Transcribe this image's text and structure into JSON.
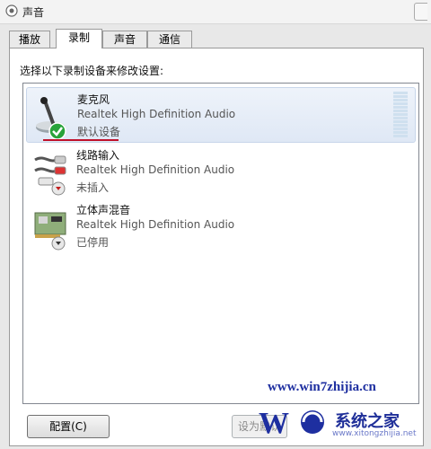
{
  "window": {
    "title": "声音"
  },
  "tabs": [
    {
      "label": "播放"
    },
    {
      "label": "录制"
    },
    {
      "label": "声音"
    },
    {
      "label": "通信"
    }
  ],
  "active_tab_index": 1,
  "prompt": "选择以下录制设备来修改设置:",
  "devices": [
    {
      "name": "麦克风",
      "driver": "Realtek High Definition Audio",
      "status": "默认设备",
      "icon": "microphone-icon",
      "badge": "green-check-icon",
      "selected": true
    },
    {
      "name": "线路输入",
      "driver": "Realtek High Definition Audio",
      "status": "未插入",
      "icon": "line-in-cable-icon",
      "badge": "red-down-arrow-icon",
      "selected": false
    },
    {
      "name": "立体声混音",
      "driver": "Realtek High Definition Audio",
      "status": "已停用",
      "icon": "sound-card-icon",
      "badge": "gray-down-arrow-icon",
      "selected": false
    }
  ],
  "buttons": {
    "configure": "配置(C)",
    "set_default": "设为默认"
  },
  "watermark": {
    "url": "www.win7zhijia.cn",
    "brand": "系统之家",
    "small": "www.xitongzhijia.net"
  },
  "colors": {
    "selection": "#dfe8f5",
    "underline": "#c0102a",
    "watermark_blue": "#1e2fa0"
  }
}
